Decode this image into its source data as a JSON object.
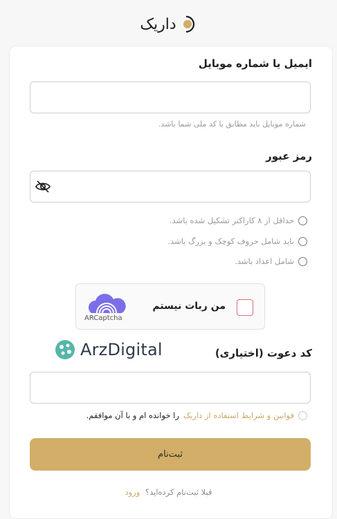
{
  "brand": {
    "logo_text": "داریک",
    "accent_color": "#d3ae68",
    "link_color": "#c9a866"
  },
  "email_section": {
    "label": "ایمیل یا شماره موبایل",
    "value": "",
    "hint": "شماره موبایل باید مطابق با کد ملی شما باشد."
  },
  "password_section": {
    "label": "رمز عبور",
    "value": "",
    "toggle_icon": "eye-slash-icon",
    "rules": [
      "حداقل از ۸ کاراکتر تشکیل شده باشد.",
      "باید شامل حروف کوچک و بزرگ باشد.",
      "شامل اعداد باشد."
    ]
  },
  "captcha": {
    "label": "من ربات نیستم",
    "brand": "ARCaptcha"
  },
  "watermark": {
    "text": "ArzDigital"
  },
  "invite_section": {
    "label": "کد دعوت (اختیاری)",
    "value": ""
  },
  "terms": {
    "link_text": "قوانین و شرایط استفاده از داریک",
    "suffix_text": "را خوانده ام و با آن موافقم."
  },
  "submit": {
    "label": "ثبت‌نام"
  },
  "login_prompt": {
    "question": "قبلا ثبت‌نام کرده‌اید؟",
    "link": "ورود"
  }
}
